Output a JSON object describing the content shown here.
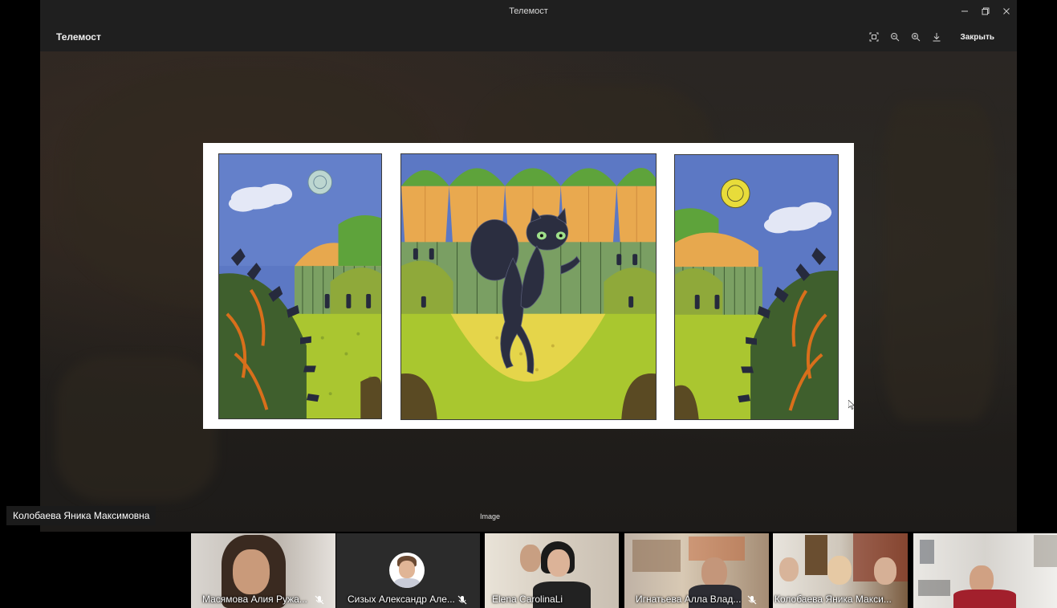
{
  "window": {
    "title": "Телемост",
    "controls": [
      "minimize-icon",
      "restore-icon",
      "close-icon"
    ]
  },
  "header": {
    "app_title": "Телемост",
    "toolbar": [
      "fit-icon",
      "zoom-out-icon",
      "zoom-in-icon",
      "download-icon"
    ],
    "close_label": "Закрыть"
  },
  "viewer": {
    "speaker_name": "Колобаева Яника Максимовна",
    "caption": "Image"
  },
  "participants": [
    {
      "name": "Масямова Алия Ружа...",
      "muted": true
    },
    {
      "name": "Сизых Александр Але...",
      "muted": true
    },
    {
      "name": "Elena CarolinaLi",
      "muted": false
    },
    {
      "name": "Игнатьева Алла Влад...",
      "muted": true
    },
    {
      "name": "Колобаева Яника Макси...",
      "muted": false
    },
    {
      "name": "",
      "muted": false
    }
  ],
  "colors": {
    "frame": "#1f1f1f",
    "background": "#000000",
    "sky": "#5b79c6",
    "grass": "#a9c72f",
    "ochre": "#e9a94f"
  }
}
